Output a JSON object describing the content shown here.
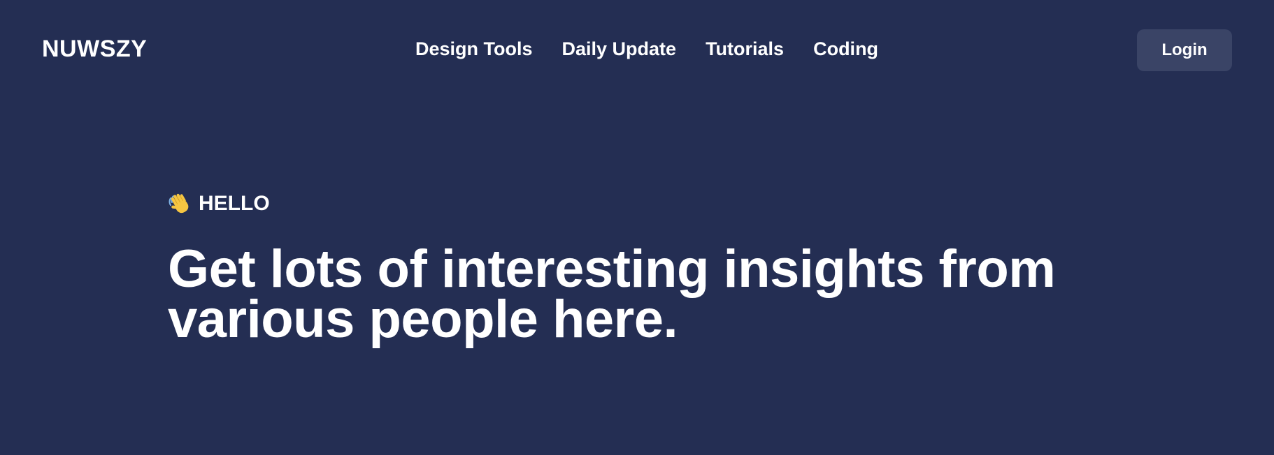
{
  "header": {
    "logo": "NUWSZY",
    "nav": [
      {
        "label": "Design Tools"
      },
      {
        "label": "Daily Update"
      },
      {
        "label": "Tutorials"
      },
      {
        "label": "Coding"
      }
    ],
    "login_label": "Login"
  },
  "hero": {
    "icon": "waving-hand-icon",
    "greeting": "HELLO",
    "title": "Get lots of interesting insights from various people here."
  },
  "colors": {
    "background": "#242e53",
    "button_background": "#3a4466",
    "text": "#ffffff",
    "wave_icon": "#f5c542"
  }
}
